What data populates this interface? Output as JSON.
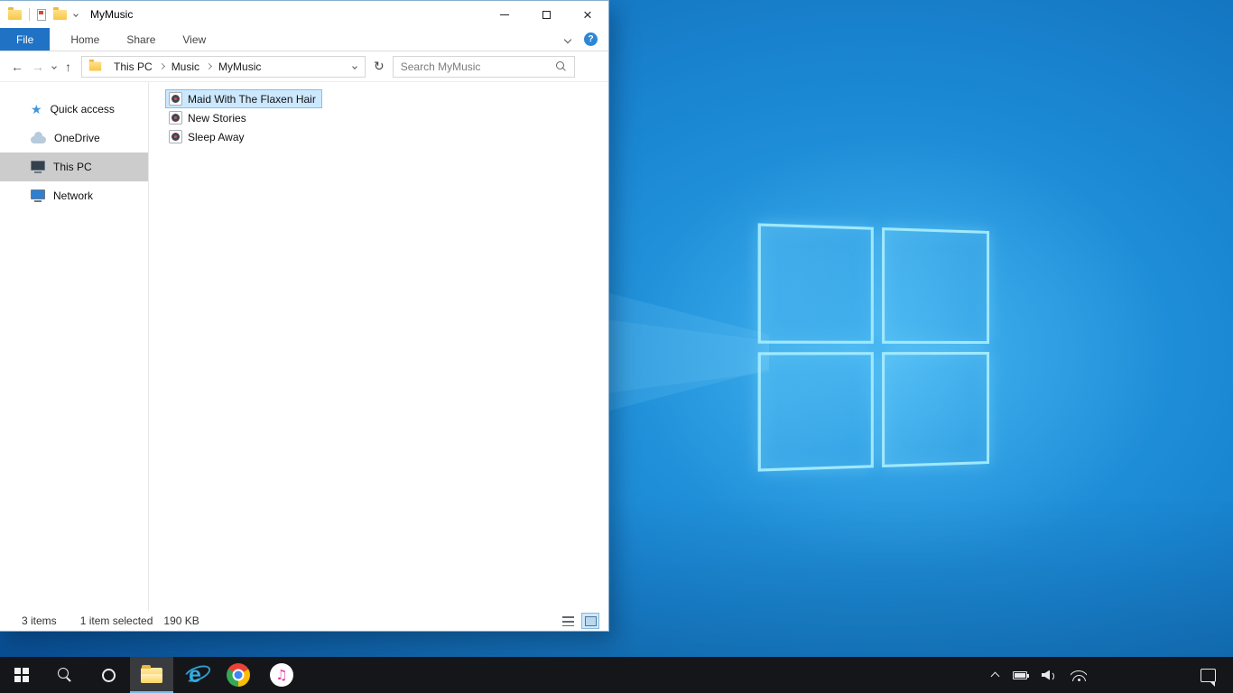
{
  "explorer": {
    "title": "MyMusic",
    "ribbon": {
      "tabs": [
        "File",
        "Home",
        "Share",
        "View"
      ],
      "help_label": "?"
    },
    "breadcrumb": [
      "This PC",
      "Music",
      "MyMusic"
    ],
    "search": {
      "placeholder": "Search MyMusic"
    },
    "sidebar": [
      {
        "label": "Quick access",
        "selected": false
      },
      {
        "label": "OneDrive",
        "selected": false
      },
      {
        "label": "This PC",
        "selected": true
      },
      {
        "label": "Network",
        "selected": false
      }
    ],
    "files": [
      {
        "name": "Maid With The Flaxen Hair",
        "selected": true
      },
      {
        "name": "New Stories",
        "selected": false
      },
      {
        "name": "Sleep Away",
        "selected": false
      }
    ],
    "status": {
      "items_count": "3 items",
      "selected_count": "1 item selected",
      "selected_size": "190 KB"
    }
  },
  "icons": {
    "back_arrow": "←",
    "forward_arrow": "→",
    "up_arrow": "↑",
    "refresh": "↻",
    "star": "★",
    "close": "×",
    "music_note": "♫",
    "ie_letter": "e"
  },
  "taskbar": {
    "apps": [
      "start",
      "search",
      "cortana",
      "file-explorer",
      "internet-explorer",
      "chrome",
      "itunes"
    ],
    "active_app": "file-explorer",
    "tray": [
      "hidden-icons-chevron",
      "battery",
      "volume",
      "network",
      "action-center",
      "show-desktop"
    ]
  },
  "colors": {
    "accent_blue": "#1f72c4",
    "selection_bg": "#cce8ff",
    "selection_border": "#7fc0f0",
    "sidebar_selected": "#cccccc",
    "taskbar_bg": "#14161a"
  }
}
